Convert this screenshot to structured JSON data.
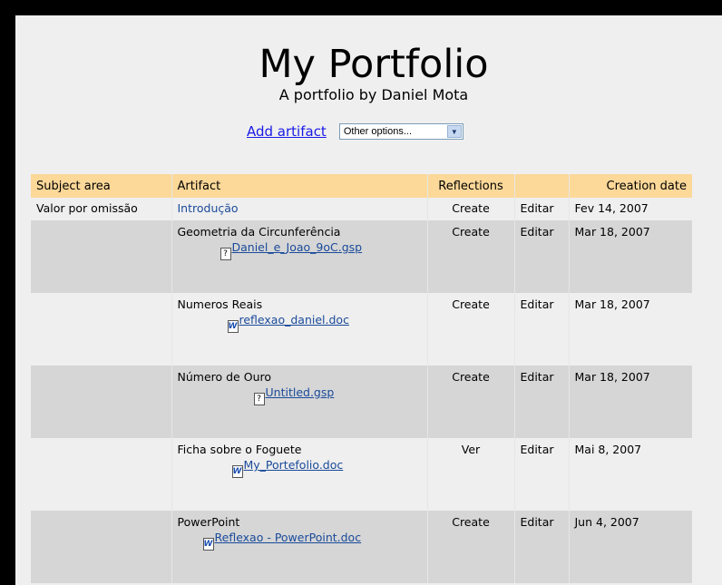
{
  "header": {
    "title": "My Portfolio",
    "subtitle": "A portfolio by Daniel Mota"
  },
  "toolbar": {
    "add_artifact_label": "Add artifact",
    "options_select": "Other options..."
  },
  "table": {
    "columns": [
      "Subject area",
      "Artifact",
      "Reflections",
      "",
      "Creation date"
    ],
    "rows": [
      {
        "subject": "Valor por omissão",
        "artifact": "Introdução",
        "file": "",
        "file_type": "",
        "reflection": "Create",
        "edit": "Editar",
        "edit_color": "blue",
        "date": "Fev 14, 2007"
      },
      {
        "subject": "",
        "artifact": "Geometria da Circunferência",
        "file": "Daniel_e_Joao_9oC.gsp",
        "file_type": "unknown",
        "reflection": "Create",
        "edit": "Editar",
        "edit_color": "red",
        "date": "Mar 18, 2007"
      },
      {
        "subject": "",
        "artifact": "Numeros Reais",
        "file": "reflexao_daniel.doc",
        "file_type": "word",
        "reflection": "Create",
        "edit": "Editar",
        "edit_color": "red",
        "date": "Mar 18, 2007"
      },
      {
        "subject": "",
        "artifact": "Número de Ouro",
        "file": "Untitled.gsp",
        "file_type": "unknown",
        "reflection": "Create",
        "edit": "Editar",
        "edit_color": "blue",
        "date": "Mar 18, 2007"
      },
      {
        "subject": "",
        "artifact": "Ficha sobre o Foguete",
        "file": "My_Portefolio.doc",
        "file_type": "word",
        "reflection": "Ver",
        "edit": "Editar",
        "edit_color": "blue",
        "date": "Mai 8, 2007"
      },
      {
        "subject": "",
        "artifact": "PowerPoint",
        "file": "Reflexao - PowerPoint.doc",
        "file_type": "word",
        "reflection": "Create",
        "edit": "Editar",
        "edit_color": "blue",
        "date": "Jun 4, 2007"
      }
    ]
  },
  "colors": {
    "header_bg": "#fcd899",
    "link_blue": "#1a4a9a",
    "edit_red": "#b01414",
    "row_light": "#efefef",
    "row_dark": "#d6d6d6"
  },
  "icons": {
    "unknown": "unknown-file-icon",
    "word": "word-doc-icon",
    "select_arrow": "chevron-down-icon"
  }
}
